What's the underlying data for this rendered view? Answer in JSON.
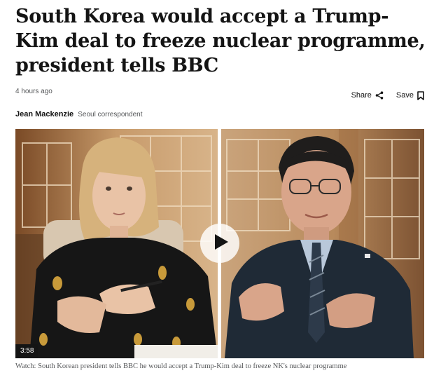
{
  "article": {
    "headline": "South Korea would accept a Trump-Kim deal to freeze nuclear programme, president tells BBC",
    "timestamp": "4 hours ago",
    "share_label": "Share",
    "save_label": "Save",
    "author_name": "Jean Mackenzie",
    "author_role": "Seoul correspondent"
  },
  "video": {
    "duration": "3:58",
    "caption": "Watch: South Korean president tells BBC he would accept a Trump-Kim deal to freeze NK's nuclear programme"
  },
  "icons": {
    "share": "share-icon",
    "save": "bookmark-icon",
    "play": "play-icon"
  },
  "colors": {
    "text": "#141414",
    "muted": "#545658",
    "duration_bg": "#141414"
  }
}
